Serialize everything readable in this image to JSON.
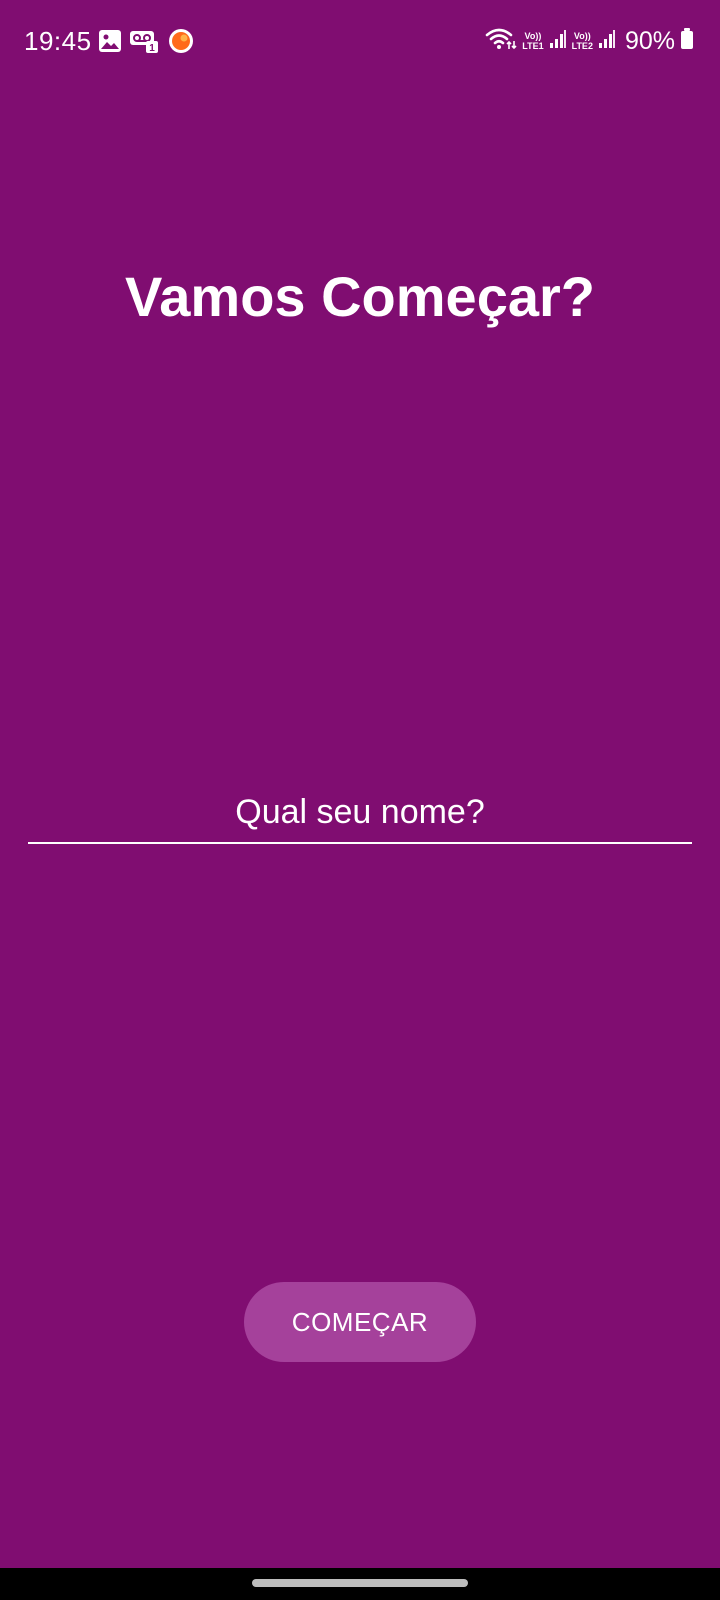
{
  "status_bar": {
    "time": "19:45",
    "notification_icons": [
      "gallery-icon",
      "voicemail-icon",
      "app-notification-icon"
    ],
    "system_icons": [
      "wifi-icon",
      "signal-sim1-icon",
      "signal-sim2-icon",
      "battery-icon"
    ],
    "sim1_top": "Vo))",
    "sim1_bottom": "LTE1",
    "sim2_top": "Vo))",
    "sim2_bottom": "LTE2",
    "battery": "90%"
  },
  "main": {
    "title": "Vamos Começar?",
    "name_input": {
      "placeholder": "Qual seu nome?",
      "value": ""
    },
    "start_button_label": "COMEÇAR"
  },
  "colors": {
    "background": "#800d71",
    "button": "#a5419b",
    "text": "#ffffff"
  }
}
